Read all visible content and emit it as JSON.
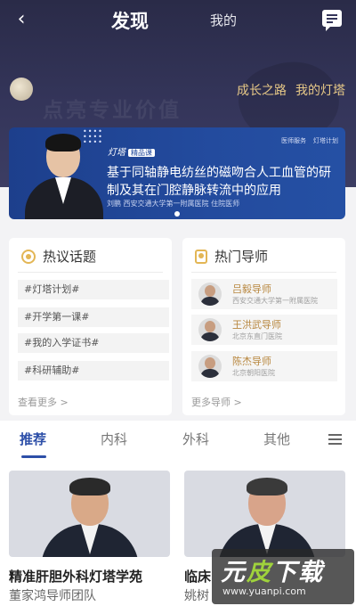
{
  "nav": {
    "tab_discover": "发现",
    "tab_mine": "我的"
  },
  "hero": {
    "watermark": "点亮专业价值",
    "link_growth": "成长之路",
    "link_lighthouse": "我的灯塔"
  },
  "banner": {
    "badge": "灯塔",
    "badge_tag": "精品课",
    "logos": [
      "医师服务",
      "灯塔计划"
    ],
    "title": "基于同轴静电纺丝的磁吻合人工血管的研制及其在门腔静脉转流中的应用",
    "author": "刘鹏  西安交通大学第一附属医院 住院医师"
  },
  "hot_topics": {
    "heading": "热议话题",
    "items": [
      "#灯塔计划#",
      "#开学第一课#",
      "#我的入学证书#",
      "#科研辅助#"
    ],
    "more": "查看更多 >"
  },
  "mentors": {
    "heading": "热门导师",
    "items": [
      {
        "name": "吕毅导师",
        "hospital": "西安交通大学第一附属医院"
      },
      {
        "name": "王洪武导师",
        "hospital": "北京东直门医院"
      },
      {
        "name": "陈杰导师",
        "hospital": "北京朝阳医院"
      }
    ],
    "more": "更多导师 >"
  },
  "categories": {
    "items": [
      "推荐",
      "内科",
      "外科",
      "其他"
    ],
    "active": "推荐"
  },
  "feed": [
    {
      "title": "精准肝胆外科灯塔学苑",
      "subtitle": "董家鸿导师团队"
    },
    {
      "title": "临床",
      "subtitle": "姚树"
    }
  ],
  "watermark": {
    "title_a": "元",
    "title_b": "皮",
    "title_c": "下载",
    "url": "www.yuanpi.com"
  },
  "colors": {
    "accent": "#2d4fa8",
    "gold": "#e6c887",
    "hero_bg": "#2a2b48"
  }
}
